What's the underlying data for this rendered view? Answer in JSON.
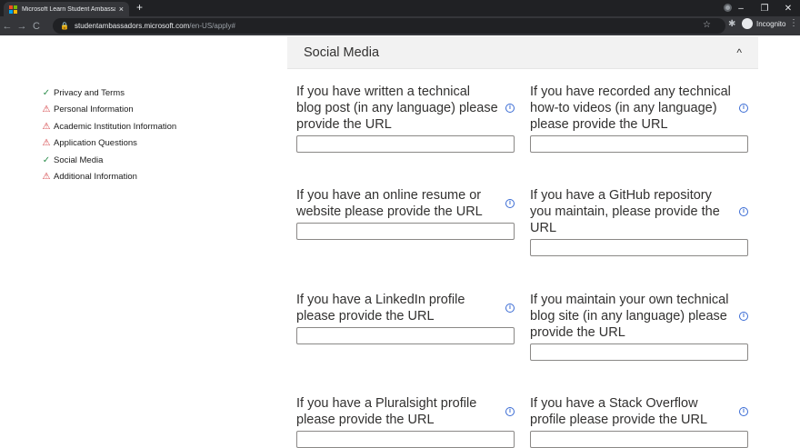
{
  "browser": {
    "tab_title": "Microsoft Learn Student Ambassa",
    "tab_close": "×",
    "new_tab": "+",
    "url_host": "studentambassadors.microsoft.com",
    "url_path": "/en-US/apply#",
    "incognito_label": "Incognito",
    "icons": {
      "back": "←",
      "forward": "→",
      "reload": "C",
      "lock": "🔒",
      "star": "☆",
      "extensions": "✱",
      "more": "⋮",
      "minimize": "–",
      "restore": "❐",
      "close": "✕"
    },
    "logo_colors": [
      "#f25022",
      "#7fba00",
      "#00a4ef",
      "#ffb900"
    ]
  },
  "sidebar": {
    "items": [
      {
        "label": "Privacy and Terms",
        "status": "ok",
        "icon": "✓"
      },
      {
        "label": "Personal Information",
        "status": "warn",
        "icon": "⚠"
      },
      {
        "label": "Academic Institution Information",
        "status": "warn",
        "icon": "⚠"
      },
      {
        "label": "Application Questions",
        "status": "warn",
        "icon": "⚠"
      },
      {
        "label": "Social Media",
        "status": "ok",
        "icon": "✓"
      },
      {
        "label": "Additional Information",
        "status": "warn",
        "icon": "⚠"
      }
    ]
  },
  "section": {
    "title": "Social Media",
    "toggle": "^"
  },
  "fields": [
    {
      "label": "If you have written a technical blog post (in any language) please provide the URL",
      "value": ""
    },
    {
      "label": "If you have recorded any technical how-to videos (in any language) please provide the URL",
      "value": ""
    },
    {
      "label": "If you have an online resume or website please provide the URL",
      "value": ""
    },
    {
      "label": "If you have a GitHub repository you maintain, please provide the URL",
      "value": ""
    },
    {
      "label": "If you have a LinkedIn profile please provide the URL",
      "value": ""
    },
    {
      "label": "If you maintain your own technical blog site (in any language) please provide the URL",
      "value": ""
    },
    {
      "label": "If you have a Pluralsight profile please provide the URL",
      "value": ""
    },
    {
      "label": "If you have a Stack Overflow profile please provide the URL",
      "value": ""
    }
  ],
  "info_glyph": "i"
}
